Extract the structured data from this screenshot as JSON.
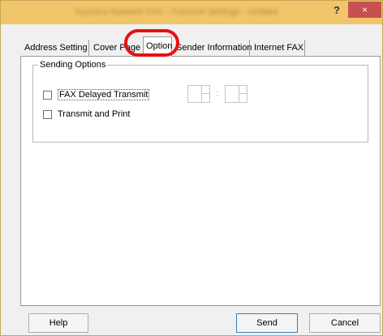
{
  "window": {
    "title": "Kyocera Network FAX - Transmit Settings - Untitled",
    "help_glyph": "?",
    "close_glyph": "×"
  },
  "tabs": [
    {
      "label": "Address Setting"
    },
    {
      "label": "Cover Page"
    },
    {
      "label": "Option",
      "active": true
    },
    {
      "label": "Sender Information"
    },
    {
      "label": "Internet FAX"
    }
  ],
  "sending_options": {
    "group_label": "Sending Options",
    "fax_delayed_transmit": {
      "label": "FAX Delayed Transmit",
      "checked": false
    },
    "transmit_and_print": {
      "label": "Transmit and Print",
      "checked": false
    },
    "time_separator": ":"
  },
  "buttons": {
    "help": "Help",
    "send": "Send",
    "cancel": "Cancel"
  },
  "colors": {
    "title_bar": "#f1c56a",
    "close_button": "#c75050",
    "highlight": "#e81010"
  }
}
